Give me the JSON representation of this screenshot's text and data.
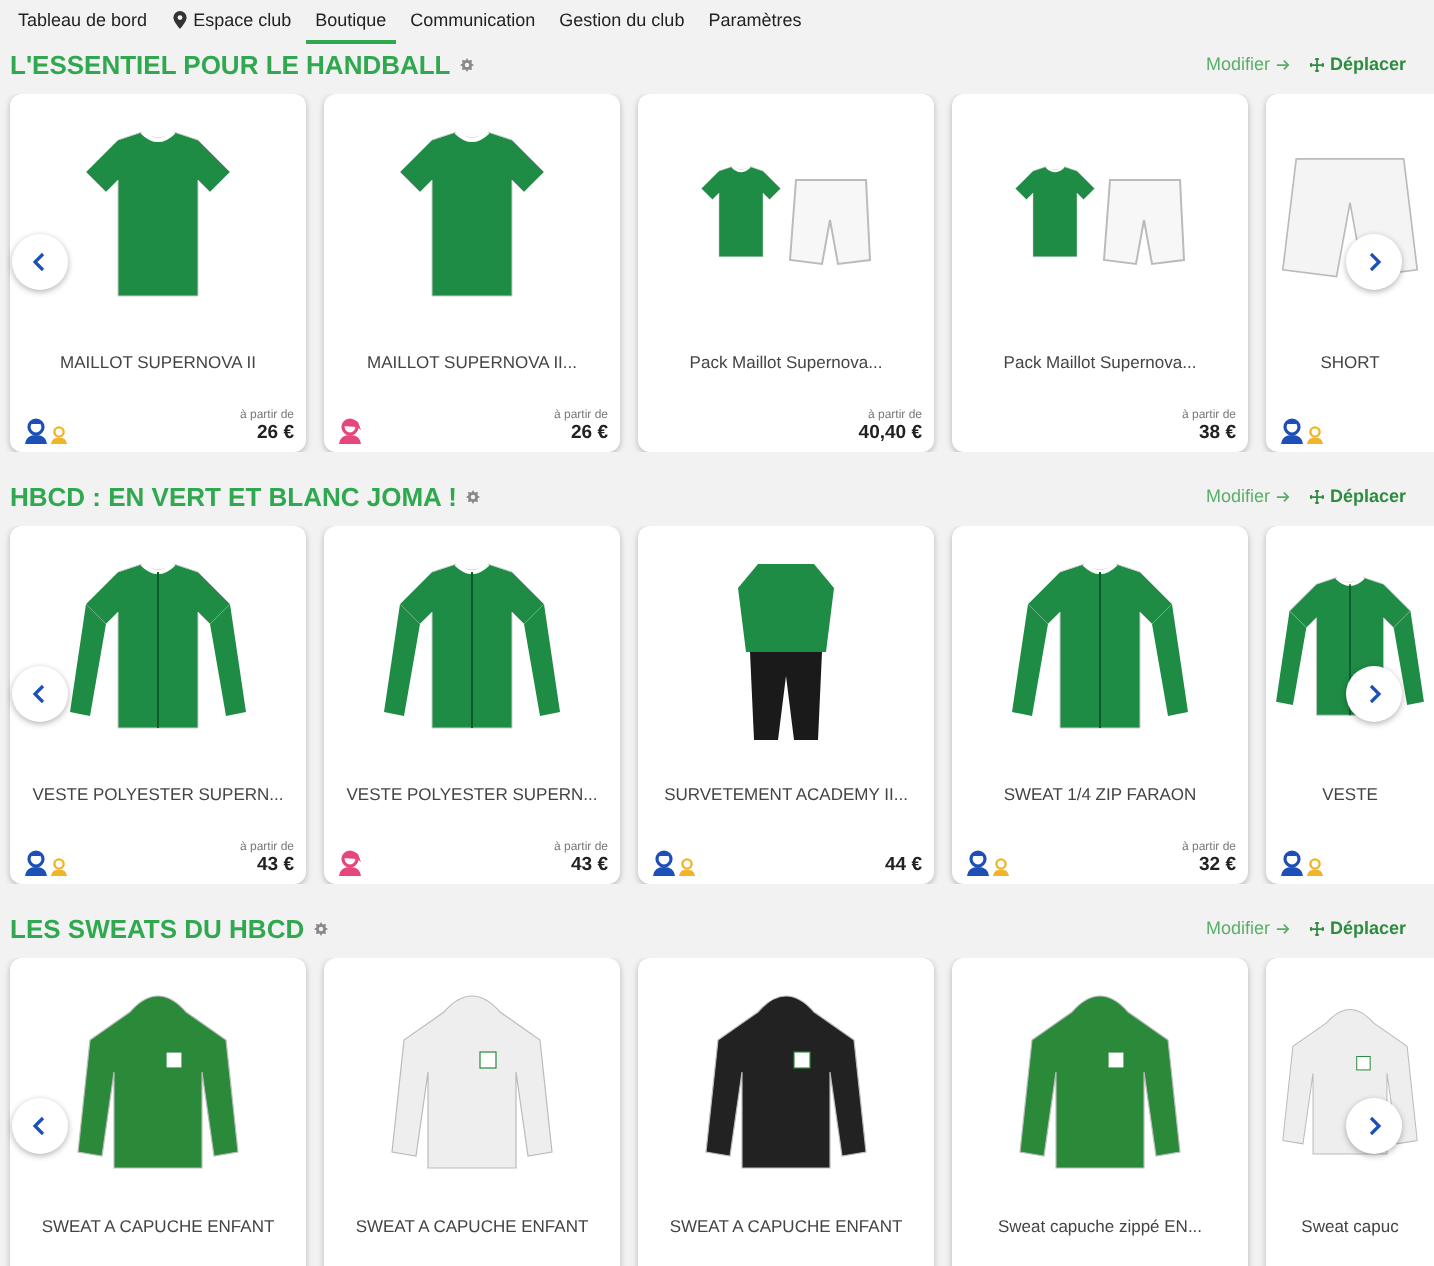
{
  "tabs": [
    {
      "label": "Tableau de bord",
      "selected": false
    },
    {
      "label": "Espace club",
      "icon": true,
      "selected": false
    },
    {
      "label": "Boutique",
      "selected": true
    },
    {
      "label": "Communication",
      "selected": false
    },
    {
      "label": "Gestion du club",
      "selected": false
    },
    {
      "label": "Paramètres",
      "selected": false
    }
  ],
  "sections": [
    {
      "title": "L'ESSENTIEL POUR LE HANDBALL",
      "edit": "Modifier",
      "move": "Déplacer",
      "products": [
        {
          "name": "MAILLOT SUPERNOVA II",
          "kind": "shirt",
          "color": "#1e8c45",
          "audience": [
            {
              "kind": "man"
            },
            {
              "kind": "child"
            }
          ],
          "from_label": "à partir de",
          "price": "26 €"
        },
        {
          "name": "MAILLOT SUPERNOVA II...",
          "kind": "shirt",
          "color": "#1e8c45",
          "audience": [
            {
              "kind": "woman"
            }
          ],
          "from_label": "à partir de",
          "price": "26 €"
        },
        {
          "name": "Pack Maillot Supernova...",
          "kind": "pack",
          "color": "#1e8c45",
          "from_label": "à partir de",
          "price": "40,40 €"
        },
        {
          "name": "Pack Maillot Supernova...",
          "kind": "pack",
          "color": "#1e8c45",
          "from_label": "à partir de",
          "price": "38 €"
        },
        {
          "name": "SHORT",
          "kind": "shorts",
          "color": "#f4f4f4",
          "audience": [
            {
              "kind": "man"
            },
            {
              "kind": "child"
            }
          ]
        }
      ]
    },
    {
      "title": "HBCD : EN VERT ET BLANC JOMA !",
      "edit": "Modifier",
      "move": "Déplacer",
      "products": [
        {
          "name": "VESTE POLYESTER SUPERN...",
          "kind": "jacket",
          "color": "#1e8c45",
          "audience": [
            {
              "kind": "man"
            },
            {
              "kind": "child"
            }
          ],
          "from_label": "à partir de",
          "price": "43 €"
        },
        {
          "name": "VESTE POLYESTER SUPERN...",
          "kind": "jacket",
          "color": "#1e8c45",
          "audience": [
            {
              "kind": "woman"
            }
          ],
          "from_label": "à partir de",
          "price": "43 €"
        },
        {
          "name": "SURVETEMENT ACADEMY II...",
          "kind": "tracksuit",
          "color": "#1e8c45",
          "audience": [
            {
              "kind": "man"
            },
            {
              "kind": "child"
            }
          ],
          "price": "44 €"
        },
        {
          "name": "SWEAT 1/4 ZIP FARAON",
          "kind": "jacket",
          "color": "#1e8c45",
          "audience": [
            {
              "kind": "man"
            },
            {
              "kind": "child"
            }
          ],
          "from_label": "à partir de",
          "price": "32 €"
        },
        {
          "name": "VESTE",
          "kind": "jacket",
          "color": "#1e8c45",
          "audience": [
            {
              "kind": "man"
            },
            {
              "kind": "child"
            }
          ]
        }
      ]
    },
    {
      "title": "LES SWEATS DU HBCD",
      "edit": "Modifier",
      "move": "Déplacer",
      "products": [
        {
          "name": "SWEAT A CAPUCHE ENFANT",
          "kind": "hoodie",
          "color": "#2a8a3a"
        },
        {
          "name": "SWEAT A CAPUCHE ENFANT",
          "kind": "hoodie",
          "color": "#eeeeee"
        },
        {
          "name": "SWEAT A CAPUCHE ENFANT",
          "kind": "hoodie",
          "color": "#222222"
        },
        {
          "name": "Sweat capuche zippé EN...",
          "kind": "hoodie",
          "color": "#2a8a3a"
        },
        {
          "name": "Sweat capuc",
          "kind": "hoodie",
          "color": "#eeeeee"
        }
      ]
    }
  ]
}
